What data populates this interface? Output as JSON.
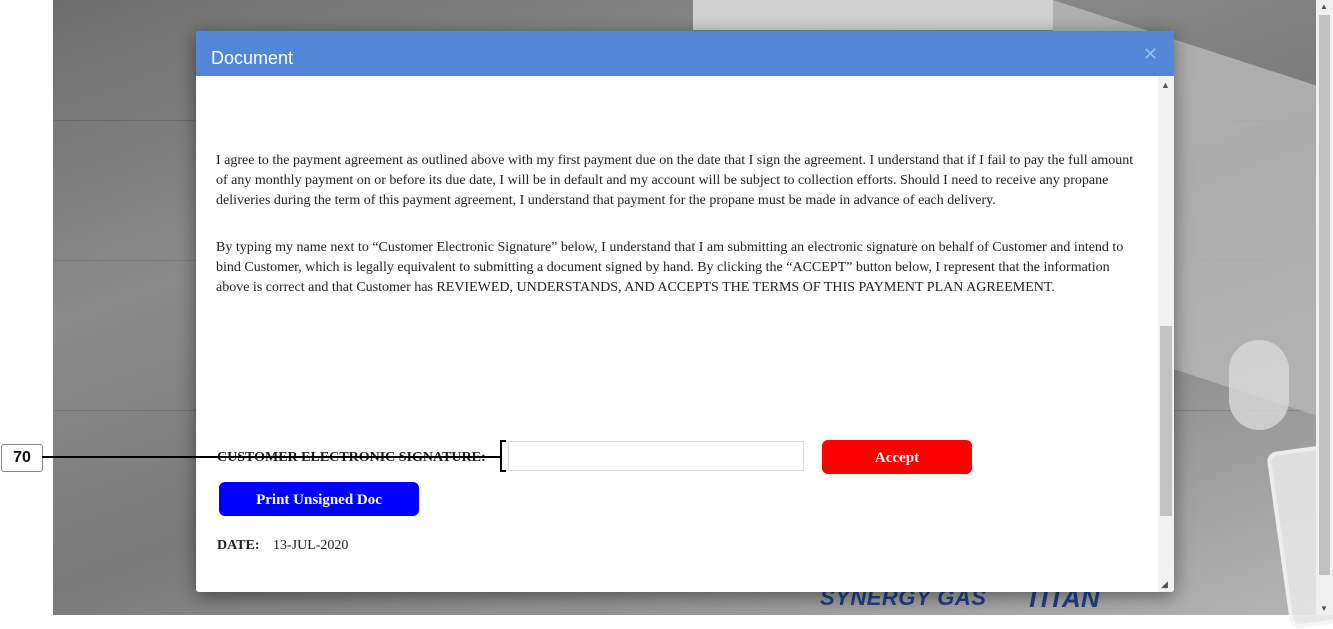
{
  "dialog": {
    "title": "Document",
    "close_icon": "close-icon",
    "paragraphs": [
      "I agree to the payment agreement as outlined above with my first payment due on the date that I sign the agreement. I understand that if I fail to pay the full amount of any monthly payment on or before its due date, I will be in default and my account will be subject to collection efforts. Should I need to receive any propane deliveries during the term of this payment agreement, I understand that payment for the propane must be made in advance of each delivery.",
      "By typing my name next to “Customer Electronic Signature” below, I understand that I am submitting an electronic signature on behalf of Customer and intend to bind Customer, which is legally equivalent to submitting a document signed by hand. By clicking the “ACCEPT” button below, I represent that the information above is correct and that Customer has REVIEWED, UNDERSTANDS, AND ACCEPTS THE TERMS OF THIS PAYMENT PLAN AGREEMENT."
    ],
    "signature_label": "CUSTOMER ELECTRONIC SIGNATURE:",
    "signature_value": "",
    "accept_label": "Accept",
    "print_label": "Print Unsigned Doc",
    "date_label": "DATE:",
    "date_value": "13-JUL-2020",
    "colors": {
      "header": "#5187d6",
      "accept": "#ff0000",
      "print": "#0000ff"
    }
  },
  "background": {
    "logo_left": "SYNERGY GAS",
    "logo_right": "TITAN"
  },
  "annotation": {
    "label": "70"
  }
}
